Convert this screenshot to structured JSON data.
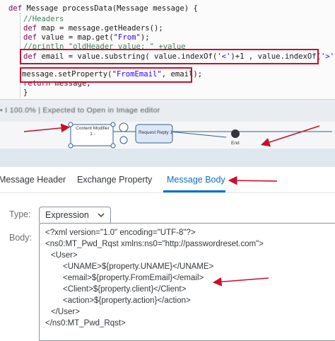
{
  "editor": {
    "lines": {
      "l1": {
        "kw": "def",
        "rest": " Message processData(Message message) {"
      },
      "l2": {
        "cmt": "//Headers"
      },
      "l3": {
        "kw": "def",
        "rest": " map = message.getHeaders();"
      },
      "l4": {
        "kw": "def",
        "pre": " value = map.get(",
        "str": "\"From\"",
        "post": ");"
      },
      "l5": {
        "cmt": "//println \"oldHeader value: \" +value"
      },
      "l6": {
        "kw": "def",
        "pre": " email = value.substring( value.indexOf(",
        "str1": "'<'",
        "mid": ")+1 , value.indexOf(",
        "str2": "'>'",
        "post": ") );"
      },
      "l7": {
        "pre": "message.setProperty(",
        "str": "\"FromEmail\"",
        "post": ", email);"
      },
      "l8": {
        "kw": "return",
        "rest": " message;"
      },
      "l9": {
        "text": "}"
      }
    }
  },
  "toolbar": {
    "status": "• I 100.0% | Expected to Open in Image editor"
  },
  "flow": {
    "content_modifier": "Content Modifier 1 -",
    "request_reply": "Request Reply 1",
    "end": "End"
  },
  "tabs": {
    "header": "Message Header",
    "property": "Exchange Property",
    "body": "Message Body"
  },
  "form": {
    "type_label": "Type:",
    "type_value": "Expression",
    "body_label": "Body:",
    "xml_lines": [
      "<?xml version=\"1.0\" encoding=\"UTF-8\"?>",
      "<ns0:MT_Pwd_Rqst xmlns:ns0=\"http://passwordreset.com\">",
      "<User>",
      "<UNAME>${property.UNAME}</UNAME>",
      "<email>${property.FromEmail}</email>",
      "<Client>${property.client}</Client>",
      "<action>${property.action}</action>",
      "</User>",
      "</ns0:MT_Pwd_Rqst>"
    ]
  },
  "colors": {
    "highlight": "#c8102e",
    "accent": "#0a6ed1"
  },
  "icons": [
    "chevron-down-icon",
    "end-event-icon",
    "arrow-annotation"
  ]
}
